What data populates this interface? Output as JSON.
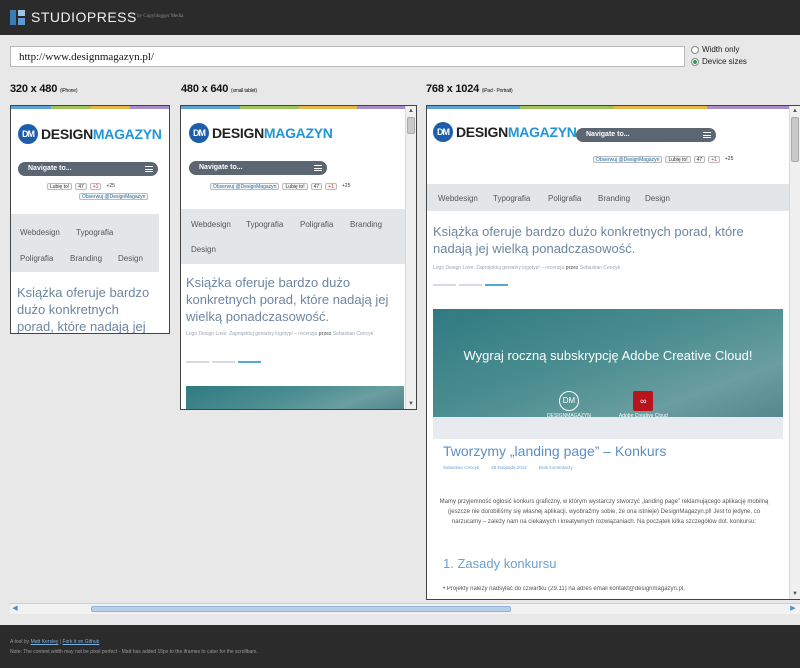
{
  "header": {
    "title": "STUDIOPRESS",
    "subtitle": "by Copyblogger Media"
  },
  "url_bar": {
    "value": "http://www.designmagazyn.pl/"
  },
  "view_options": [
    {
      "label": "Width only",
      "selected": false
    },
    {
      "label": "Device sizes",
      "selected": true
    }
  ],
  "devices": [
    {
      "size": "320 x 480",
      "name": "(iPhone)"
    },
    {
      "size": "480 x 640",
      "name": "(small tablet)"
    },
    {
      "size": "768 x 1024",
      "name": "(iPad - Portrait)"
    }
  ],
  "site": {
    "logo_badge": "DM",
    "logo_dark": "DESIGN",
    "logo_blue": "MAGAZYN",
    "nav_label": "Navigate to...",
    "like": "Lubię to!",
    "like_count": "47",
    "gplus": "+1",
    "gplus_count": "+25",
    "follow": "Obserwuj @DesignMagazyn",
    "menu": [
      "Webdesign",
      "Typografia",
      "Poligrafia",
      "Branding",
      "Design"
    ],
    "lead": "Książka oferuje bardzo dużo konkretnych porad, które nadają jej wielką ponadczasowość.",
    "meta_text": "Logo Design Love: Zaprojektuj genialny logotyp! – recenzja",
    "meta_przez": "przez",
    "meta_author": "Sebastian Cencyk",
    "banner_title": "Wygraj roczną subskrypcję Adobe Creative Cloud!",
    "banner_logo_dm": "DESIGNMAGAZYN",
    "banner_logo_adobe": "Adobe Creative Cloud",
    "post_title": "Tworzymy „landing page” – Konkurs",
    "post_author": "Sebastian Cencyk",
    "post_date": "26 listopada 2012",
    "post_comments": "Brak komentarzy",
    "post_body": "Mamy przyjemność ogłosić konkurs graficzny, w którym wystarczy stworzyć „landing page” reklamującego aplikację mobilną (jeszcze nie dorobiliśmy się własnej aplikacji, wyobraźmy sobie, że ona istnieje) DesignMagazyn.pl! Jest to jedyne, co narzucamy – zależy nam na ciekawych i kreatywnych rozwiązaniach. Na początek kilka szczegółów dot. konkursu:",
    "post_heading": "1. Zasady konkursu",
    "post_item": "• Projekty należy nadsyłać do czwartku (29.11) na adres email kontakt@designmagazyn.pl,"
  },
  "footer": {
    "line1_prefix": "A tool by",
    "line1_link1": "Matt Kersley",
    "line1_sep": "|",
    "line1_link2": "Fork it on Github",
    "line2": "Note: The content width may not be pixel perfect - Matt has added 15px to the iframes to cater for the scrollbars."
  },
  "colors": {
    "brand_blue": "#2196d6",
    "nav_gray": "#5b6672",
    "lead_blue": "#6d86a2"
  }
}
